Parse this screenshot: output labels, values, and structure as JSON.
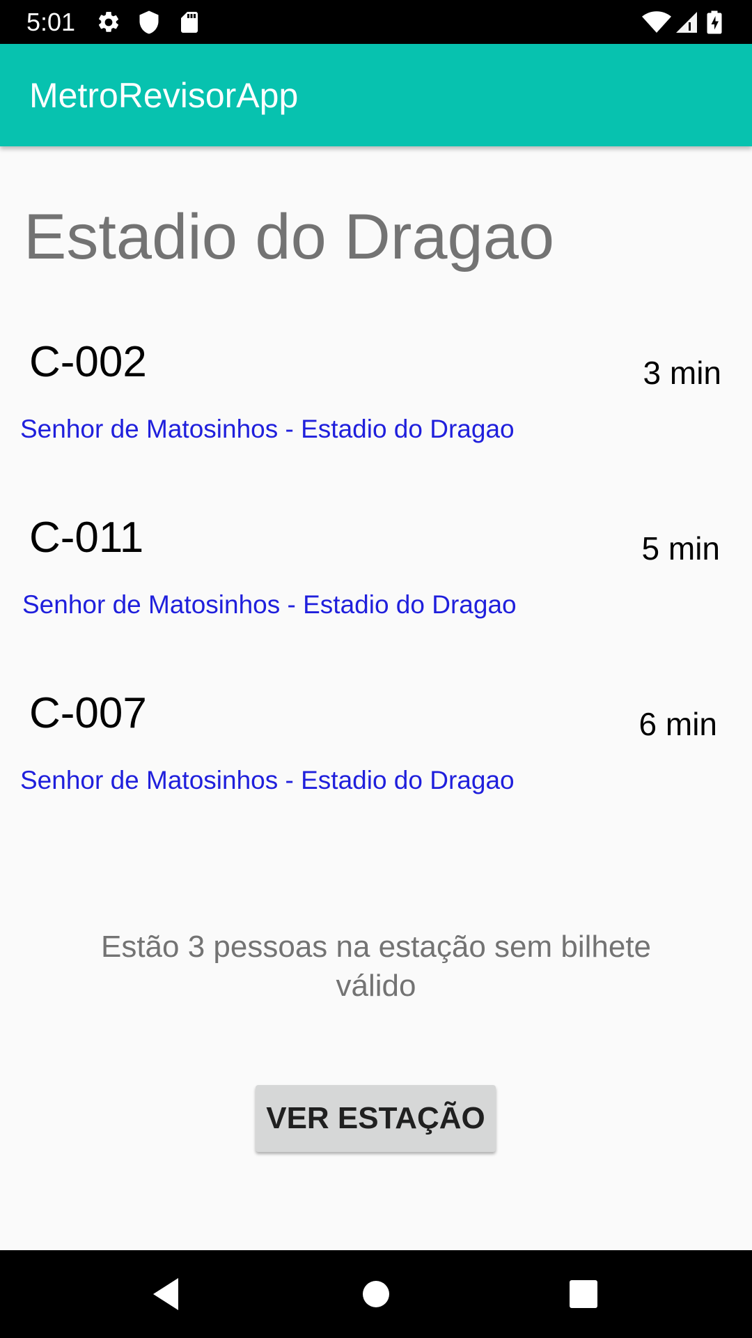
{
  "status_bar": {
    "time": "5:01",
    "left_icons": [
      "gear-icon",
      "shield-icon",
      "sd-card-icon"
    ],
    "right_icons": [
      "wifi-icon",
      "signal-icon",
      "battery-icon"
    ]
  },
  "app_bar": {
    "title": "MetroRevisorApp",
    "color": "#07c2af"
  },
  "station": {
    "name": "Estadio do Dragao"
  },
  "trains": [
    {
      "code": "C-002",
      "eta": "3 min",
      "route": "Senhor de Matosinhos - Estadio do Dragao"
    },
    {
      "code": "C-011",
      "eta": "5 min",
      "route": "Senhor de Matosinhos - Estadio do Dragao"
    },
    {
      "code": "C-007",
      "eta": "6 min",
      "route": "Senhor de Matosinhos - Estadio do Dragao"
    }
  ],
  "summary": {
    "text": "Estão 3 pessoas na estação sem bilhete válido"
  },
  "actions": {
    "view_station_label": "VER ESTAÇÃO"
  },
  "nav_bar": {
    "buttons": [
      "back-icon",
      "home-icon",
      "recents-icon"
    ]
  },
  "colors": {
    "accent": "#07c2af",
    "route_text": "#1f1fdc",
    "muted_text": "#737373"
  }
}
